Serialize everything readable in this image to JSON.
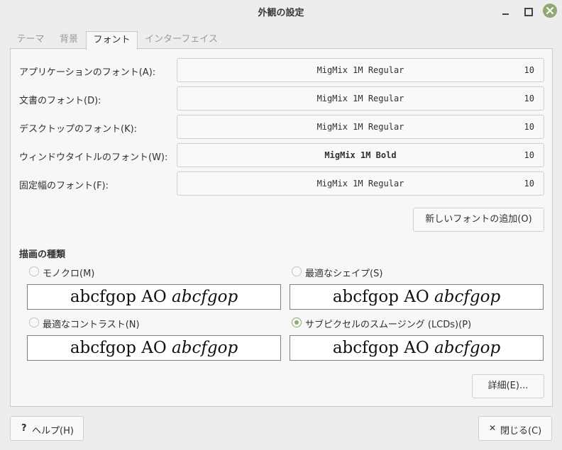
{
  "window": {
    "title": "外観の設定"
  },
  "tabs": [
    {
      "label": "テーマ"
    },
    {
      "label": "背景"
    },
    {
      "label": "フォント"
    },
    {
      "label": "インターフェイス"
    }
  ],
  "fonts": [
    {
      "label": "アプリケーションのフォント(A):",
      "name": "MigMix 1M Regular",
      "size": "10"
    },
    {
      "label": "文書のフォント(D):",
      "name": "MigMix 1M Regular",
      "size": "10"
    },
    {
      "label": "デスクトップのフォント(K):",
      "name": "MigMix 1M Regular",
      "size": "10"
    },
    {
      "label": "ウィンドウタイトルのフォント(W):",
      "name": "MigMix 1M Bold",
      "size": "10"
    },
    {
      "label": "固定幅のフォント(F):",
      "name": "MigMix 1M Regular",
      "size": "10"
    }
  ],
  "add_font_label": "新しいフォントの追加(O)",
  "rendering": {
    "title": "描画の種類",
    "options": [
      {
        "label": "モノクロ(M)",
        "checked": false,
        "sample_regular": "abcfgop AO ",
        "sample_italic": "abcfgop"
      },
      {
        "label": "最適なシェイプ(S)",
        "checked": false,
        "sample_regular": "abcfgop AO ",
        "sample_italic": "abcfgop"
      },
      {
        "label": "最適なコントラスト(N)",
        "checked": false,
        "sample_regular": "abcfgop AO ",
        "sample_italic": "abcfgop"
      },
      {
        "label": "サブピクセルのスムージング (LCDs)(P)",
        "checked": true,
        "sample_regular": "abcfgop AO ",
        "sample_italic": "abcfgop"
      }
    ]
  },
  "details_label": "詳細(E)...",
  "help": {
    "icon": "?",
    "label": "ヘルプ(H)"
  },
  "close": {
    "icon": "✕",
    "label": "閉じる(C)"
  },
  "colors": {
    "accent": "#8fa876",
    "background": "#ededed",
    "panel": "#f7f7f7"
  }
}
